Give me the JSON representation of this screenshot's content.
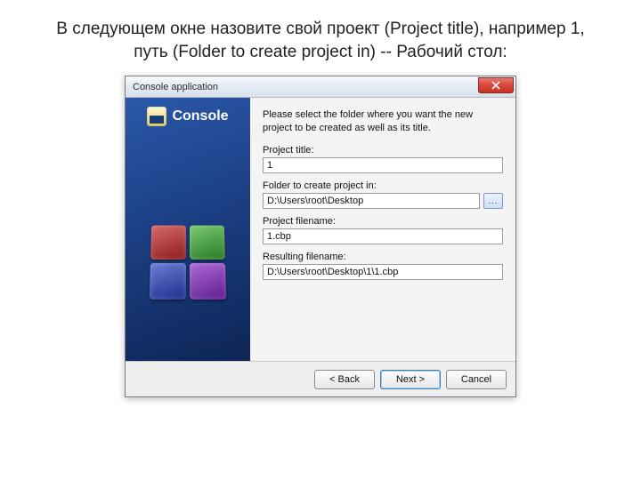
{
  "slide": {
    "title": "В следующем окне назовите свой проект (Project title), например 1, путь (Folder to create project in) -- Рабочий стол:"
  },
  "dialog": {
    "title": "Console application",
    "banner": "Console",
    "instructions": "Please select the folder where you want the new project to be created as well as its title.",
    "fields": {
      "project_title": {
        "label": "Project title:",
        "value": "1"
      },
      "folder": {
        "label": "Folder to create project in:",
        "value": "D:\\Users\\root\\Desktop",
        "browse": "..."
      },
      "project_filename": {
        "label": "Project filename:",
        "value": "1.cbp"
      },
      "resulting_filename": {
        "label": "Resulting filename:",
        "value": "D:\\Users\\root\\Desktop\\1\\1.cbp"
      }
    },
    "buttons": {
      "back": "< Back",
      "next": "Next >",
      "cancel": "Cancel"
    }
  }
}
